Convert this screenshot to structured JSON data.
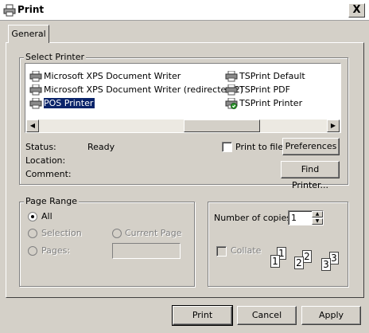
{
  "window": {
    "title": "Print",
    "close_glyph": "X"
  },
  "tabs": [
    {
      "label": "General"
    }
  ],
  "select_printer": {
    "group_label": "Select Printer",
    "printers": [
      {
        "name": "Microsoft XPS Document Writer",
        "icon": "printer-icon",
        "selected": false
      },
      {
        "name": "Microsoft XPS Document Writer (redirected 2)",
        "icon": "printer-icon",
        "selected": false
      },
      {
        "name": "POS Printer",
        "icon": "printer-icon",
        "selected": true
      },
      {
        "name": "TSPrint Default",
        "icon": "printer-icon",
        "selected": false
      },
      {
        "name": "TSPrint PDF",
        "icon": "printer-icon",
        "selected": false
      },
      {
        "name": "TSPrint Printer",
        "icon": "default-printer-icon",
        "selected": false
      }
    ],
    "status_label": "Status:",
    "status_value": "Ready",
    "location_label": "Location:",
    "comment_label": "Comment:",
    "print_to_file_label": "Print to file",
    "preferences_label": "Preferences",
    "find_printer_label": "Find Printer..."
  },
  "page_range": {
    "group_label": "Page Range",
    "all_label": "All",
    "selection_label": "Selection",
    "current_page_label": "Current Page",
    "pages_label": "Pages:",
    "pages_value": ""
  },
  "copies": {
    "number_label": "Number of copies:",
    "number_value": "1",
    "collate_label": "Collate",
    "collate_pages": [
      "1",
      "1",
      "2",
      "2",
      "3",
      "3"
    ]
  },
  "buttons": {
    "print_label": "Print",
    "cancel_label": "Cancel",
    "apply_label": "Apply"
  },
  "colors": {
    "face": "#d4d0c8",
    "selection": "#0a246a",
    "list_bg": "#ffffff"
  }
}
